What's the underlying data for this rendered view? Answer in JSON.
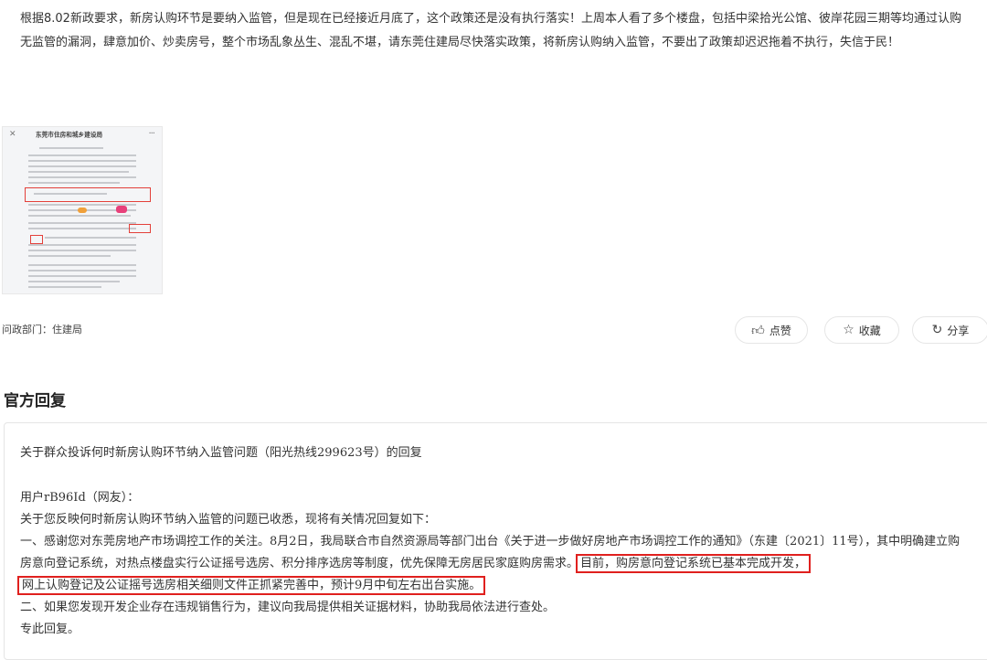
{
  "question": {
    "text": "根据8.02新政要求，新房认购环节是要纳入监管，但是现在已经接近月底了，这个政策还是没有执行落实！上周本人看了多个楼盘，包括中梁拾光公馆、彼岸花园三期等均通过认购无监管的漏洞，肆意加价、炒卖房号，整个市场乱象丛生、混乱不堪，请东莞住建局尽快落实政策，将新房认购纳入监管，不要出了政策却迟迟拖着不执行，失信于民！"
  },
  "attachment": {
    "doc_title": "东莞市住房和城乡建设局",
    "close_icon": "close-icon",
    "more_icon": "more-icon",
    "highlight_color": "#e3403a"
  },
  "dept": {
    "label": "问政部门：住建局"
  },
  "actions": {
    "like_label": "点赞",
    "like_icon": "thumbs-up-icon",
    "favorite_label": "收藏",
    "favorite_icon": "star-icon",
    "share_label": "分享",
    "share_icon": "share-icon"
  },
  "reply": {
    "section_title": "官方回复",
    "title": "关于群众投诉何时新房认购环节纳入监管问题（阳光热线299623号）的回复",
    "greeting": "用户rB96Id（网友）：",
    "line1": "关于您反映何时新房认购环节纳入监管的问题已收悉，现将有关情况回复如下：",
    "para1_a": "一、感谢您对东莞房地产市场调控工作的关注。8月2日，我局联合市自然资源局等部门出台《关于进一步做好房地产市场调控工作的通知》（东建〔2021〕11号），其中明确建立购房意向登记系统，对热点楼盘实行公证摇号选房、积分排序选房等制度，优先保障无房居民家庭购房需求。",
    "para1_hl": "目前，购房意向登记系统已基本完成开发，",
    "para1_hl2": "网上认购登记及公证摇号选房相关细则文件正抓紧完善中，预计9月中旬左右出台实施。",
    "para2": "二、如果您发现开发企业存在违规销售行为，建议向我局提供相关证据材料，协助我局依法进行查处。",
    "closing": "专此回复。",
    "highlight_color": "#e0201e"
  }
}
